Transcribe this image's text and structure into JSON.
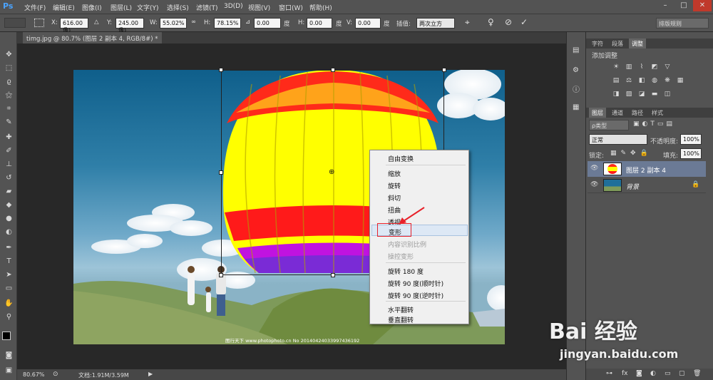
{
  "app": {
    "logo": "Ps"
  },
  "menubar": {
    "items": [
      "文件(F)",
      "编辑(E)",
      "图像(I)",
      "图层(L)",
      "文字(Y)",
      "选择(S)",
      "滤镜(T)",
      "3D(D)",
      "视图(V)",
      "窗口(W)",
      "帮助(H)"
    ],
    "window_buttons": [
      "–",
      "□",
      "✕"
    ]
  },
  "options": {
    "x_label": "X:",
    "x_value": "616.00 像)",
    "y_label": "Y:",
    "y_value": "245.00 像)",
    "w_label": "W:",
    "w_value": "55.02%",
    "h_label": "H:",
    "h_value": "78.15%",
    "angle_value": "0.00",
    "angle_unit": "度",
    "hskew_label": "H:",
    "hskew_value": "0.00",
    "hskew_unit": "度",
    "vskew_label": "V:",
    "vskew_value": "0.00",
    "vskew_unit": "度",
    "interp_label": "插值:",
    "interp_value": "两次立方",
    "workspace": "排版规则"
  },
  "document": {
    "tab_title": "timg.jpg @ 80.7% (图层 2 副本 4, RGB/8#) *",
    "watermark": "图行天下 www.photophoto.cn  No 20140424033997436192"
  },
  "status": {
    "zoom": "80.67%",
    "doc_info": "文档:1.91M/3.59M"
  },
  "panels": {
    "top_tabs": [
      "字符",
      "段落",
      "调整"
    ],
    "adjust_title": "添加调整",
    "layer_tabs": [
      "图层",
      "通道",
      "路径",
      "样式"
    ],
    "kind_filter": "ρ类型",
    "blend_mode": "正常",
    "opacity_label": "不透明度:",
    "opacity_value": "100%",
    "lock_label": "锁定:",
    "fill_label": "填充:",
    "fill_value": "100%",
    "layers": [
      {
        "name": "图层 2 副本 4",
        "selected": true
      },
      {
        "name": "背景",
        "selected": false
      }
    ],
    "footer_icons": [
      "link-icon",
      "fx-icon",
      "mask-icon",
      "adjustment-icon",
      "group-icon",
      "new-layer-icon",
      "trash-icon"
    ]
  },
  "context_menu": {
    "groups": [
      [
        {
          "label": "自由变换",
          "disabled": false
        }
      ],
      [
        {
          "label": "缩放",
          "disabled": false
        },
        {
          "label": "旋转",
          "disabled": false
        },
        {
          "label": "斜切",
          "disabled": false
        },
        {
          "label": "扭曲",
          "disabled": false
        },
        {
          "label": "透视",
          "disabled": false
        },
        {
          "label": "变形",
          "disabled": false,
          "highlighted": true
        },
        {
          "label": "内容识别比例",
          "disabled": true
        },
        {
          "label": "操控变形",
          "disabled": true
        }
      ],
      [
        {
          "label": "旋转 180 度",
          "disabled": false
        },
        {
          "label": "旋转 90 度(顺时针)",
          "disabled": false
        },
        {
          "label": "旋转 90 度(逆时针)",
          "disabled": false
        }
      ],
      [
        {
          "label": "水平翻转",
          "disabled": false
        },
        {
          "label": "垂直翻转",
          "disabled": false
        }
      ]
    ]
  },
  "branding": {
    "baidu_logo": "Bai 经验",
    "baidu_url": "jingyan.baidu.com"
  },
  "colors": {
    "accent": "#e8212a",
    "highlight": "#dde8f5"
  }
}
